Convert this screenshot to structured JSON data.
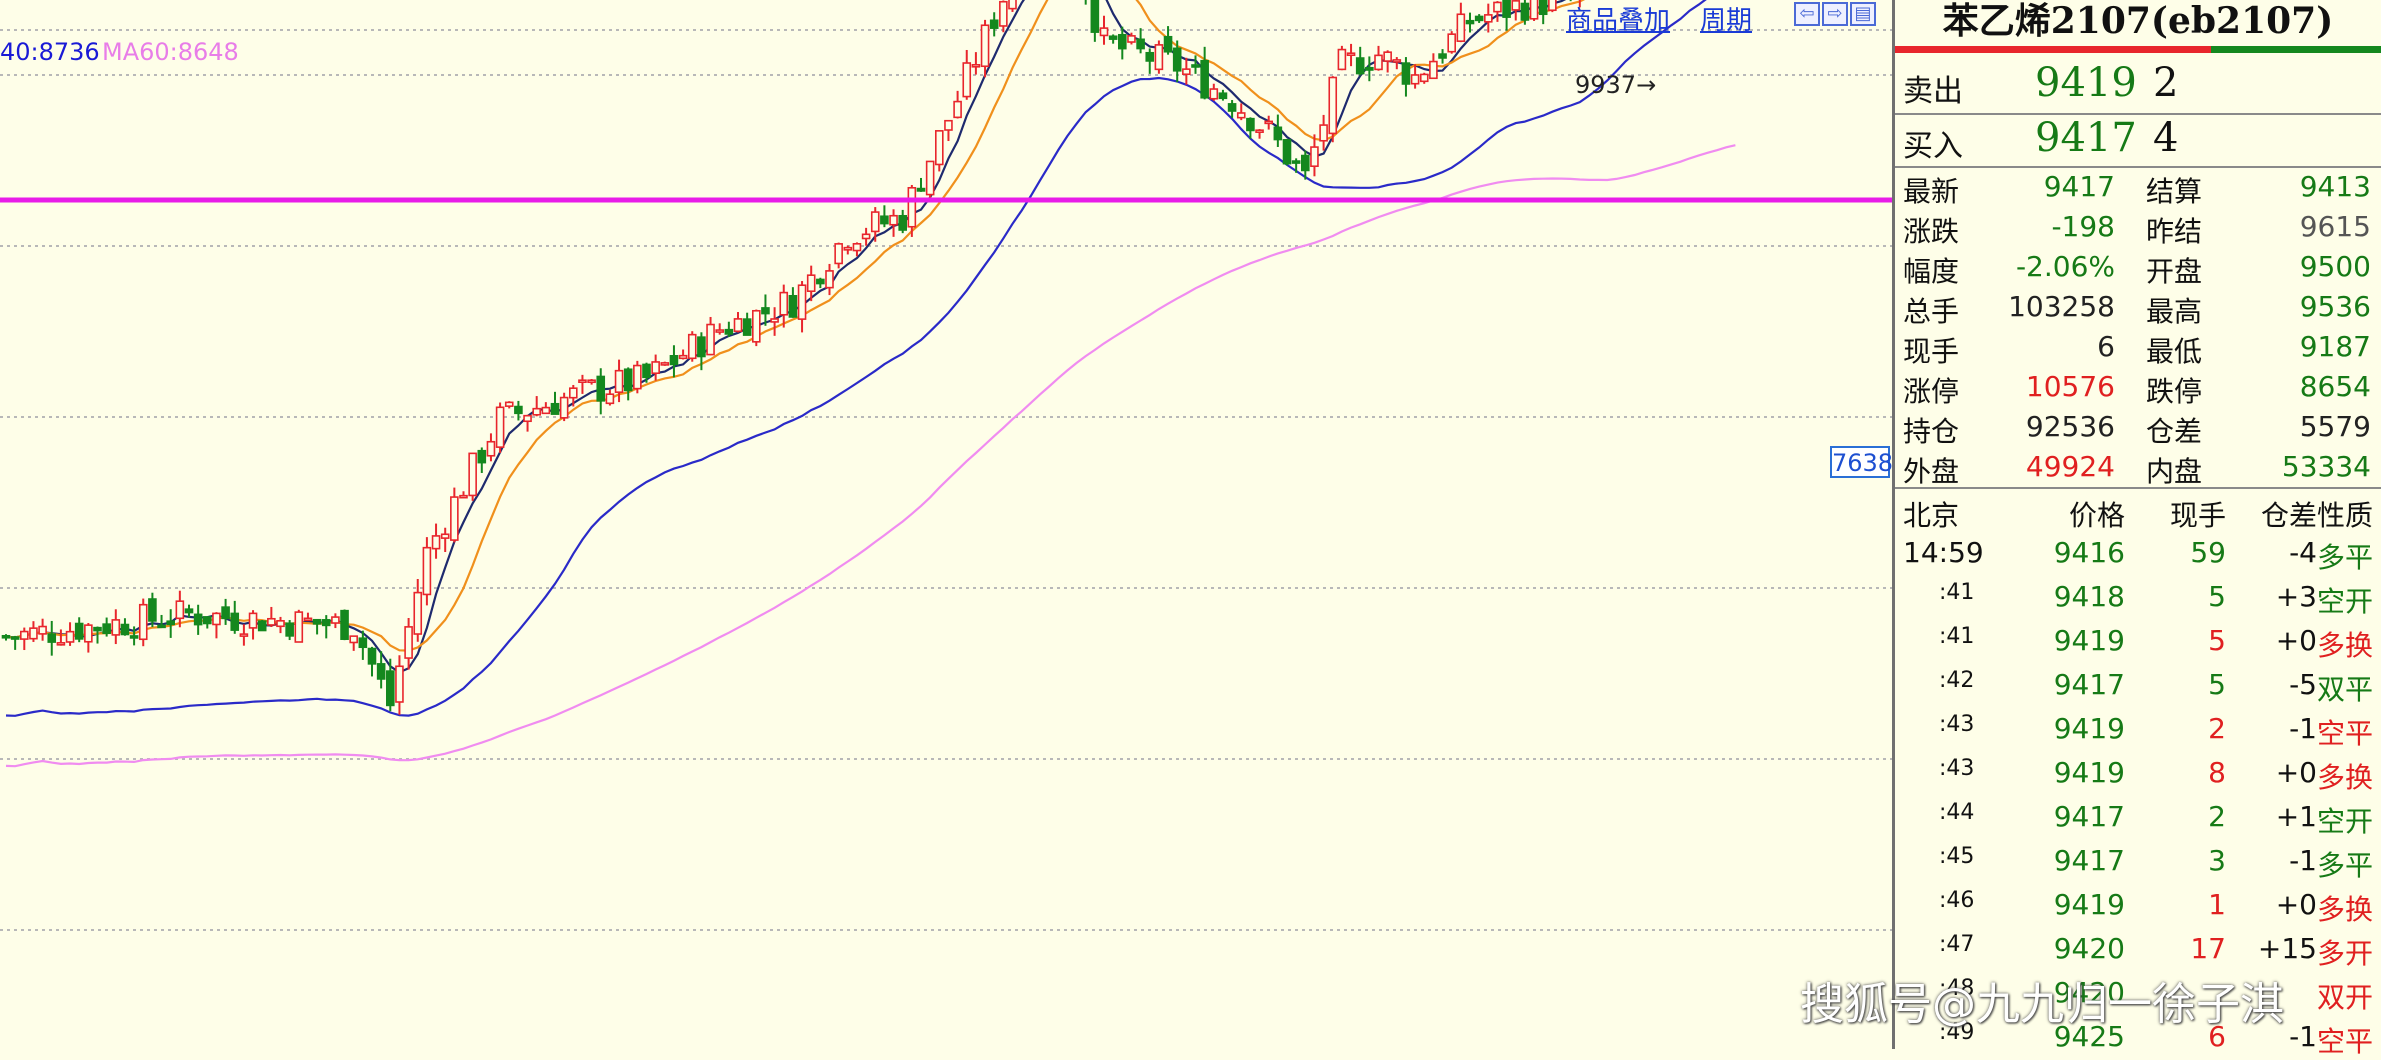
{
  "toolbar": {
    "overlay": "商品叠加",
    "period": "周期",
    "btn_left": "⇦",
    "btn_right": "⇨",
    "btn_menu": "▤"
  },
  "indicators": [
    {
      "text": "40:8736",
      "color": "#1a1ad6"
    },
    {
      "text": "MA60:8648",
      "color": "#e87de8"
    }
  ],
  "chart": {
    "high_label": "9937→",
    "price_tag": "7638",
    "hline_value": 9380,
    "colors": {
      "up": "#e8262c",
      "down": "#14881e",
      "ma5": "#1e2a6e",
      "ma10": "#f0901c",
      "ma20": "#2a2ac8",
      "ma60": "#f08cf0",
      "hline": "#e81ce8"
    }
  },
  "quote": {
    "title": "苯乙烯2107(eb2107)",
    "order_book": [
      {
        "label": "卖出",
        "price": "9419",
        "volume": "2"
      },
      {
        "label": "买入",
        "price": "9417",
        "volume": "4"
      }
    ],
    "fields": [
      {
        "l1": "最新",
        "v1": "9417",
        "c1": "#167a16",
        "l2": "结算",
        "v2": "9413",
        "c2": "#167a16"
      },
      {
        "l1": "涨跌",
        "v1": "-198",
        "c1": "#167a16",
        "l2": "昨结",
        "v2": "9615",
        "c2": "#555555"
      },
      {
        "l1": "幅度",
        "v1": "-2.06%",
        "c1": "#167a16",
        "l2": "开盘",
        "v2": "9500",
        "c2": "#167a16"
      },
      {
        "l1": "总手",
        "v1": "103258",
        "c1": "#222222",
        "l2": "最高",
        "v2": "9536",
        "c2": "#167a16"
      },
      {
        "l1": "现手",
        "v1": "6",
        "c1": "#222222",
        "l2": "最低",
        "v2": "9187",
        "c2": "#167a16"
      },
      {
        "l1": "涨停",
        "v1": "10576",
        "c1": "#e02020",
        "l2": "跌停",
        "v2": "8654",
        "c2": "#167a16"
      },
      {
        "l1": "持仓",
        "v1": "92536",
        "c1": "#222222",
        "l2": "仓差",
        "v2": "5579",
        "c2": "#222222"
      },
      {
        "l1": "外盘",
        "v1": "49924",
        "c1": "#e02020",
        "l2": "内盘",
        "v2": "53334",
        "c2": "#167a16"
      }
    ],
    "ticks_header": {
      "time": "北京",
      "price": "价格",
      "vol": "现手",
      "oi": "仓差",
      "nature": "性质"
    },
    "ticks": [
      {
        "time": "14:59",
        "price": "9416",
        "vol": "59",
        "oi": "-4",
        "nature": "多平",
        "vc": "#167a16",
        "nc": "#167a16"
      },
      {
        "time": ":41",
        "price": "9418",
        "vol": "5",
        "oi": "+3",
        "nature": "空开",
        "vc": "#167a16",
        "nc": "#167a16"
      },
      {
        "time": ":41",
        "price": "9419",
        "vol": "5",
        "oi": "+0",
        "nature": "多换",
        "vc": "#e02020",
        "nc": "#e02020"
      },
      {
        "time": ":42",
        "price": "9417",
        "vol": "5",
        "oi": "-5",
        "nature": "双平",
        "vc": "#167a16",
        "nc": "#167a16"
      },
      {
        "time": ":43",
        "price": "9419",
        "vol": "2",
        "oi": "-1",
        "nature": "空平",
        "vc": "#e02020",
        "nc": "#e02020"
      },
      {
        "time": ":43",
        "price": "9419",
        "vol": "8",
        "oi": "+0",
        "nature": "多换",
        "vc": "#e02020",
        "nc": "#e02020"
      },
      {
        "time": ":44",
        "price": "9417",
        "vol": "2",
        "oi": "+1",
        "nature": "空开",
        "vc": "#167a16",
        "nc": "#167a16"
      },
      {
        "time": ":45",
        "price": "9417",
        "vol": "3",
        "oi": "-1",
        "nature": "多平",
        "vc": "#167a16",
        "nc": "#167a16"
      },
      {
        "time": ":46",
        "price": "9419",
        "vol": "1",
        "oi": "+0",
        "nature": "多换",
        "vc": "#e02020",
        "nc": "#e02020"
      },
      {
        "time": ":47",
        "price": "9420",
        "vol": "17",
        "oi": "+15",
        "nature": "多开",
        "vc": "#e02020",
        "nc": "#e02020"
      },
      {
        "time": ":48",
        "price": "9420",
        "vol": "",
        "oi": "",
        "nature": "双开",
        "vc": "#e02020",
        "nc": "#e02020"
      },
      {
        "time": ":49",
        "price": "9425",
        "vol": "6",
        "oi": "-1",
        "nature": "空平",
        "vc": "#e02020",
        "nc": "#e02020"
      }
    ]
  },
  "watermark": "搜狐号@九九归一徐子淇"
}
